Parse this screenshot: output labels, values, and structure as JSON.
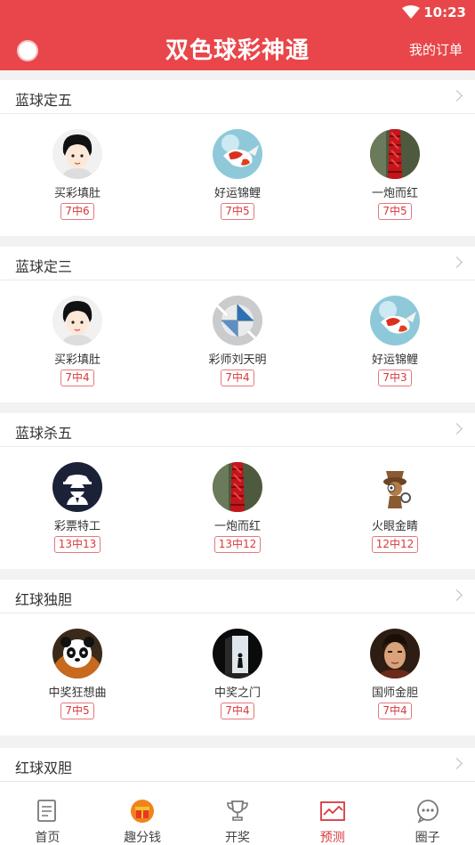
{
  "status_bar": {
    "time": "10:23"
  },
  "header": {
    "title": "双色球彩神通",
    "orders_label": "我的订单"
  },
  "sections": [
    {
      "title": "蓝球定五",
      "experts": [
        {
          "name": "买彩填肚",
          "record": "7中6",
          "avatar": "boy"
        },
        {
          "name": "好运锦鲤",
          "record": "7中5",
          "avatar": "koi"
        },
        {
          "name": "一炮而红",
          "record": "7中5",
          "avatar": "firecracker"
        }
      ]
    },
    {
      "title": "蓝球定三",
      "experts": [
        {
          "name": "买彩填肚",
          "record": "7中4",
          "avatar": "boy"
        },
        {
          "name": "彩师刘天明",
          "record": "7中4",
          "avatar": "globe"
        },
        {
          "name": "好运锦鲤",
          "record": "7中3",
          "avatar": "koi"
        }
      ]
    },
    {
      "title": "蓝球杀五",
      "experts": [
        {
          "name": "彩票特工",
          "record": "13中13",
          "avatar": "agent"
        },
        {
          "name": "一炮而红",
          "record": "13中12",
          "avatar": "firecracker"
        },
        {
          "name": "火眼金睛",
          "record": "12中12",
          "avatar": "detective"
        }
      ]
    },
    {
      "title": "红球独胆",
      "experts": [
        {
          "name": "中奖狂想曲",
          "record": "7中5",
          "avatar": "panda"
        },
        {
          "name": "中奖之门",
          "record": "7中4",
          "avatar": "door"
        },
        {
          "name": "国师金胆",
          "record": "7中4",
          "avatar": "man"
        }
      ]
    }
  ],
  "last_section": {
    "title": "红球双胆"
  },
  "tabs": [
    {
      "label": "首页",
      "icon": "document-icon",
      "active": false
    },
    {
      "label": "趣分钱",
      "icon": "gift-icon",
      "active": false
    },
    {
      "label": "开奖",
      "icon": "trophy-icon",
      "active": false
    },
    {
      "label": "预测",
      "icon": "chart-icon",
      "active": true
    },
    {
      "label": "圈子",
      "icon": "chat-icon",
      "active": false
    }
  ],
  "colors": {
    "brand": "#e8464a",
    "record_red": "#d9383c"
  }
}
